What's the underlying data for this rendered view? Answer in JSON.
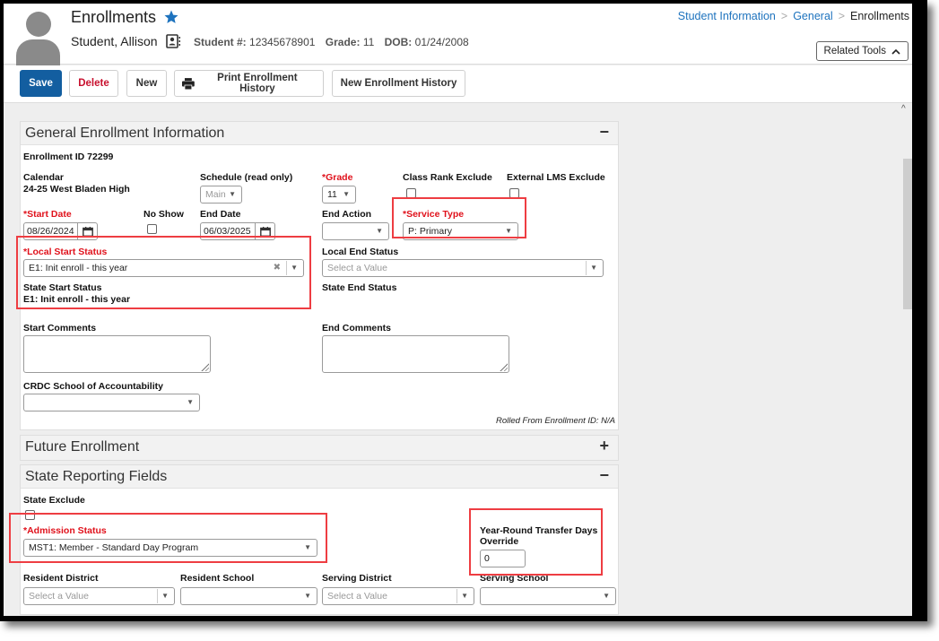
{
  "header": {
    "title": "Enrollments",
    "student_name": "Student, Allison",
    "student_number_label": "Student #:",
    "student_number": "12345678901",
    "grade_label": "Grade:",
    "grade": "11",
    "dob_label": "DOB:",
    "dob": "01/24/2008",
    "breadcrumb": [
      "Student Information",
      "General",
      "Enrollments"
    ],
    "related_tools_label": "Related Tools"
  },
  "toolbar": {
    "save_label": "Save",
    "delete_label": "Delete",
    "new_label": "New",
    "print_label": "Print Enrollment History",
    "new_history_label": "New Enrollment History"
  },
  "general": {
    "title": "General Enrollment Information",
    "toggle": "−",
    "enrollment_id": "Enrollment ID 72299",
    "calendar_label": "Calendar",
    "calendar_value": "24-25 West Bladen High",
    "schedule_label": "Schedule (read only)",
    "schedule_value": "Main",
    "grade_label": "*Grade",
    "grade_value": "11",
    "class_rank_label": "Class Rank Exclude",
    "external_lms_label": "External LMS Exclude",
    "start_date_label": "*Start Date",
    "start_date_value": "08/26/2024",
    "no_show_label": "No Show",
    "end_date_label": "End Date",
    "end_date_value": "06/03/2025",
    "end_action_label": "End Action",
    "end_action_value": "",
    "service_type_label": "*Service Type",
    "service_type_value": "P: Primary",
    "local_start_label": "*Local Start Status",
    "local_start_value": "E1: Init enroll - this year",
    "state_start_label": "State Start Status",
    "state_start_value": "E1: Init enroll - this year",
    "local_end_label": "Local End Status",
    "local_end_placeholder": "Select a Value",
    "state_end_label": "State End Status",
    "start_comments_label": "Start Comments",
    "end_comments_label": "End Comments",
    "crdc_label": "CRDC School of Accountability",
    "crdc_value": "",
    "rolled_from": "Rolled From Enrollment ID: N/A"
  },
  "future": {
    "title": "Future Enrollment",
    "toggle": "+"
  },
  "state_reporting": {
    "title": "State Reporting Fields",
    "toggle": "−",
    "state_exclude_label": "State Exclude",
    "admission_label": "*Admission Status",
    "admission_value": "MST1: Member - Standard Day Program",
    "year_round_label_1": "Year-Round Transfer Days",
    "year_round_label_2": "Override",
    "year_round_value": "0",
    "resident_district_label": "Resident District",
    "resident_district_placeholder": "Select a Value",
    "resident_school_label": "Resident School",
    "serving_district_label": "Serving District",
    "serving_district_placeholder": "Select a Value",
    "serving_school_label": "Serving School"
  },
  "colors": {
    "primary": "#135ea0",
    "danger": "#c8102e",
    "required": "#e0111b",
    "highlight": "#ee3d42",
    "link": "#1e73be"
  }
}
